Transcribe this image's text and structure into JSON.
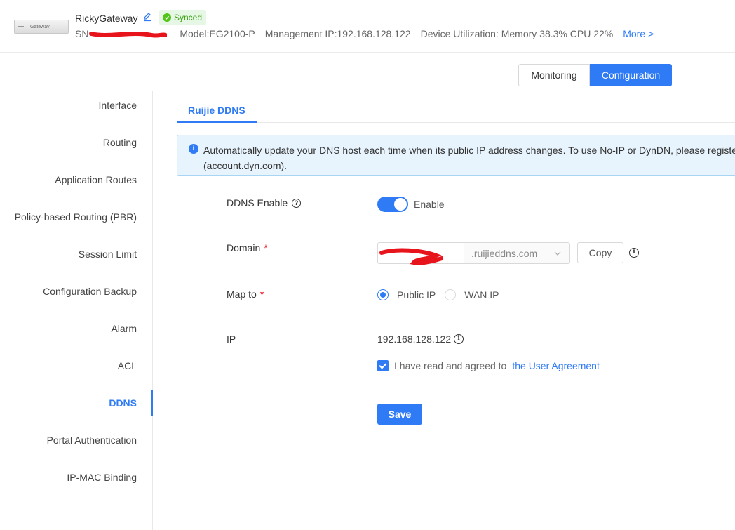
{
  "header": {
    "device_image_label": "Gateway",
    "device_name": "RickyGateway",
    "status_badge": "Synced",
    "sn_label": "SN:",
    "model": "Model:EG2100-P",
    "management_ip": "Management IP:192.168.128.122",
    "utilization": "Device Utilization: Memory 38.3% CPU 22%",
    "more_link": "More >"
  },
  "mode_switch": {
    "monitoring": "Monitoring",
    "configuration": "Configuration"
  },
  "sidebar": {
    "items": [
      {
        "label": "Interface"
      },
      {
        "label": "Routing"
      },
      {
        "label": "Application Routes"
      },
      {
        "label": "Policy-based Routing (PBR)"
      },
      {
        "label": "Session Limit"
      },
      {
        "label": "Configuration Backup"
      },
      {
        "label": "Alarm"
      },
      {
        "label": "ACL"
      },
      {
        "label": "DDNS"
      },
      {
        "label": "Portal Authentication"
      },
      {
        "label": "IP-MAC Binding"
      }
    ],
    "active": "DDNS"
  },
  "tab": {
    "label": "Ruijie DDNS"
  },
  "alert": {
    "line1": "Automatically update your DNS host each time when its public IP address changes. To use No-IP or DynDN, please register",
    "line2": "(account.dyn.com)."
  },
  "form": {
    "ddns_enable_label": "DDNS Enable",
    "ddns_enable_state": "Enable",
    "domain_label": "Domain",
    "required_mark": "*",
    "domain_suffix": ".ruijieddns.com",
    "copy_button": "Copy",
    "map_to_label": "Map to",
    "map_options": [
      {
        "label": "Public IP",
        "checked": true
      },
      {
        "label": "WAN IP",
        "checked": false
      }
    ],
    "ip_label": "IP",
    "ip_value": "192.168.128.122",
    "agreement_text": "I have read and agreed to",
    "agreement_link": "the User Agreement",
    "save_button": "Save"
  },
  "colors": {
    "accent": "#2f7bf5",
    "success": "#52c41a",
    "required": "#f5222d",
    "redaction": "#e8141c"
  },
  "icons": {
    "edit": "edit-icon",
    "synced": "check-circle-icon",
    "help": "question-circle-icon",
    "info": "info-circle-icon",
    "chevron": "chevron-down-icon"
  }
}
